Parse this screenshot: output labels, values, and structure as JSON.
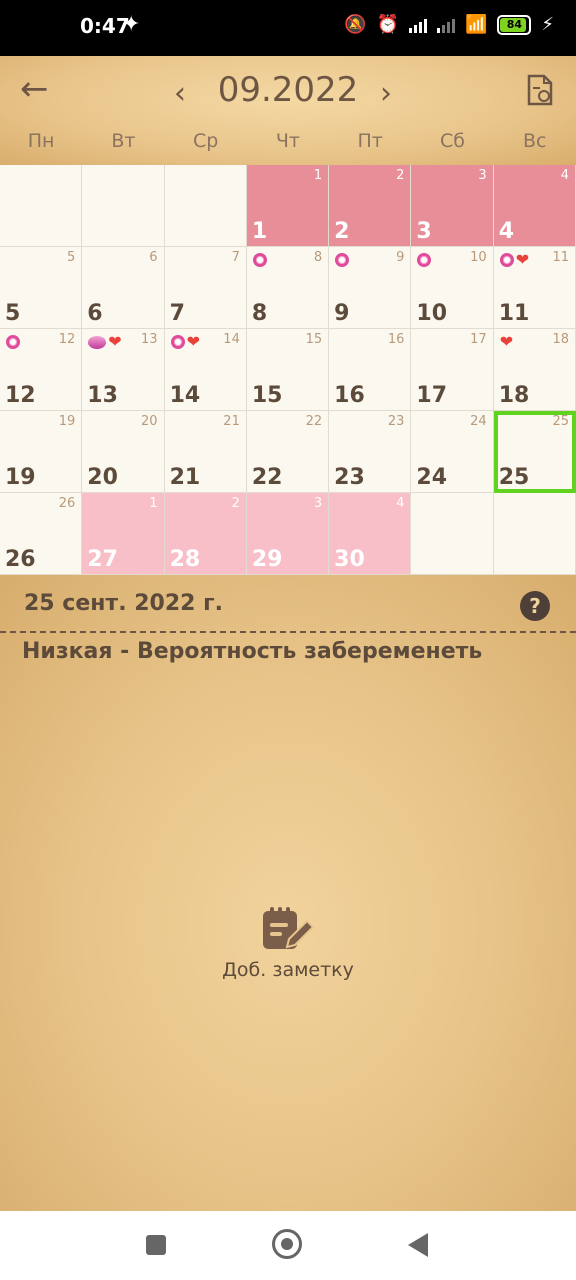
{
  "status_bar": {
    "time": "0:47",
    "battery": "84"
  },
  "header": {
    "month_title": "09.2022",
    "prev_symbol": "‹",
    "next_symbol": "›",
    "back_symbol": "←",
    "weekdays": [
      "Пн",
      "Вт",
      "Ср",
      "Чт",
      "Пт",
      "Сб",
      "Вс"
    ]
  },
  "calendar": {
    "rows": [
      [
        {
          "big": "",
          "small": "",
          "state": "empty"
        },
        {
          "big": "",
          "small": "",
          "state": "empty"
        },
        {
          "big": "",
          "small": "",
          "state": "empty"
        },
        {
          "big": "1",
          "small": "1",
          "state": "period"
        },
        {
          "big": "2",
          "small": "2",
          "state": "period"
        },
        {
          "big": "3",
          "small": "3",
          "state": "period"
        },
        {
          "big": "4",
          "small": "4",
          "state": "period"
        }
      ],
      [
        {
          "big": "5",
          "small": "5",
          "state": "normal"
        },
        {
          "big": "6",
          "small": "6",
          "state": "normal"
        },
        {
          "big": "7",
          "small": "7",
          "state": "normal"
        },
        {
          "big": "8",
          "small": "8",
          "state": "normal",
          "marks": [
            "flower"
          ]
        },
        {
          "big": "9",
          "small": "9",
          "state": "normal",
          "marks": [
            "flower"
          ]
        },
        {
          "big": "10",
          "small": "10",
          "state": "normal",
          "marks": [
            "flower"
          ]
        },
        {
          "big": "11",
          "small": "11",
          "state": "normal",
          "marks": [
            "flower",
            "heart"
          ]
        }
      ],
      [
        {
          "big": "12",
          "small": "12",
          "state": "normal",
          "marks": [
            "flower"
          ]
        },
        {
          "big": "13",
          "small": "13",
          "state": "normal",
          "marks": [
            "egg",
            "heart"
          ]
        },
        {
          "big": "14",
          "small": "14",
          "state": "normal",
          "marks": [
            "flower",
            "heart"
          ]
        },
        {
          "big": "15",
          "small": "15",
          "state": "normal"
        },
        {
          "big": "16",
          "small": "16",
          "state": "normal"
        },
        {
          "big": "17",
          "small": "17",
          "state": "normal"
        },
        {
          "big": "18",
          "small": "18",
          "state": "normal",
          "marks": [
            "heart"
          ]
        }
      ],
      [
        {
          "big": "19",
          "small": "19",
          "state": "normal"
        },
        {
          "big": "20",
          "small": "20",
          "state": "normal"
        },
        {
          "big": "21",
          "small": "21",
          "state": "normal"
        },
        {
          "big": "22",
          "small": "22",
          "state": "normal"
        },
        {
          "big": "23",
          "small": "23",
          "state": "normal"
        },
        {
          "big": "24",
          "small": "24",
          "state": "normal"
        },
        {
          "big": "25",
          "small": "25",
          "state": "selected"
        }
      ],
      [
        {
          "big": "26",
          "small": "26",
          "state": "normal"
        },
        {
          "big": "27",
          "small": "1",
          "state": "pred"
        },
        {
          "big": "28",
          "small": "2",
          "state": "pred"
        },
        {
          "big": "29",
          "small": "3",
          "state": "pred"
        },
        {
          "big": "30",
          "small": "4",
          "state": "pred"
        },
        {
          "big": "",
          "small": "",
          "state": "empty"
        },
        {
          "big": "",
          "small": "",
          "state": "empty"
        }
      ]
    ]
  },
  "info": {
    "date_title": "25 сент. 2022 г.",
    "help_symbol": "?",
    "probability": "Низкая - Вероятность забеременеть",
    "add_note_label": "Доб. заметку"
  },
  "colors": {
    "period": "#e88e98",
    "predicted": "#f8bfc8",
    "selected_outline": "#5fd31e",
    "text_brown": "#5c4a3a"
  }
}
